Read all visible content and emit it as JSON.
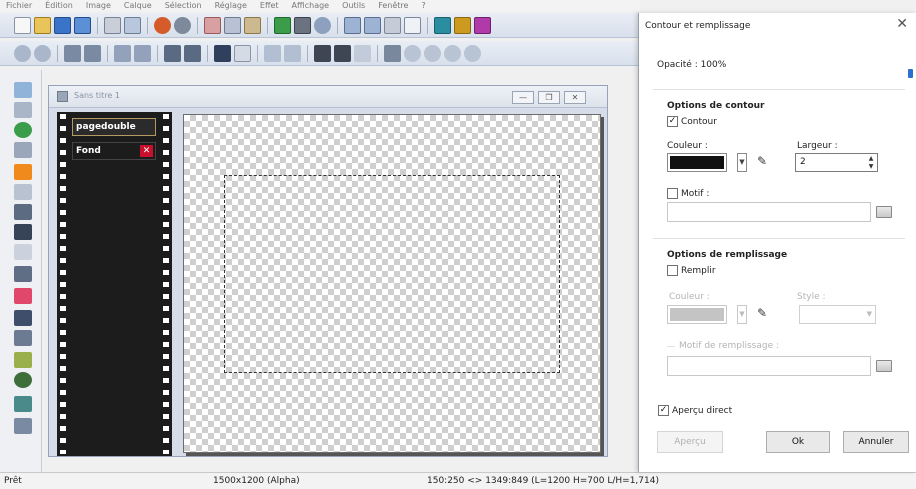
{
  "menubar": {
    "items": [
      "Fichier",
      "Édition",
      "Image",
      "Calque",
      "Sélection",
      "Réglage",
      "Effet",
      "Affichage",
      "Outils",
      "Fenêtre",
      "?"
    ]
  },
  "document": {
    "title": "Sans titre 1",
    "window_buttons": [
      "—",
      "❐",
      "✕"
    ],
    "layers": [
      {
        "name": "pagedouble"
      },
      {
        "name": "Fond"
      }
    ],
    "delete_glyph": "✕"
  },
  "status": {
    "ready": "Prêt",
    "image_info": "1500x1200 (Alpha)",
    "coords": "150:250 <> 1349:849 (L=1200 H=700 L/H=1,714)"
  },
  "dialog": {
    "title": "Contour et remplissage",
    "close_glyph": "✕",
    "opacity_label": "Opacité : 100%",
    "opacity_value": 100,
    "contour_section": "Options de contour",
    "contour_checkbox": "Contour",
    "contour_checked": true,
    "color_label": "Couleur :",
    "contour_color": "#111111",
    "width_label": "Largeur :",
    "width_value": "2",
    "motif_checkbox": "Motif :",
    "motif_checked": false,
    "fill_section": "Options de remplissage",
    "fill_checkbox": "Remplir",
    "fill_checked": false,
    "fill_color_label": "Couleur :",
    "fill_color": "#c4c4c4",
    "style_label": "Style :",
    "fill_motif_label": "Motif de remplissage :",
    "preview_checkbox": "Aperçu direct",
    "preview_checked": true,
    "btn_preview": "Aperçu",
    "btn_ok": "Ok",
    "btn_cancel": "Annuler"
  },
  "colors": {
    "toolbar_icon_colors": [
      "#3a74c9",
      "#d65b2b",
      "#3b9d4a",
      "#b03aa8",
      "#2a8ea0",
      "#cc9a1e"
    ],
    "accent": "#2c6fd1"
  }
}
